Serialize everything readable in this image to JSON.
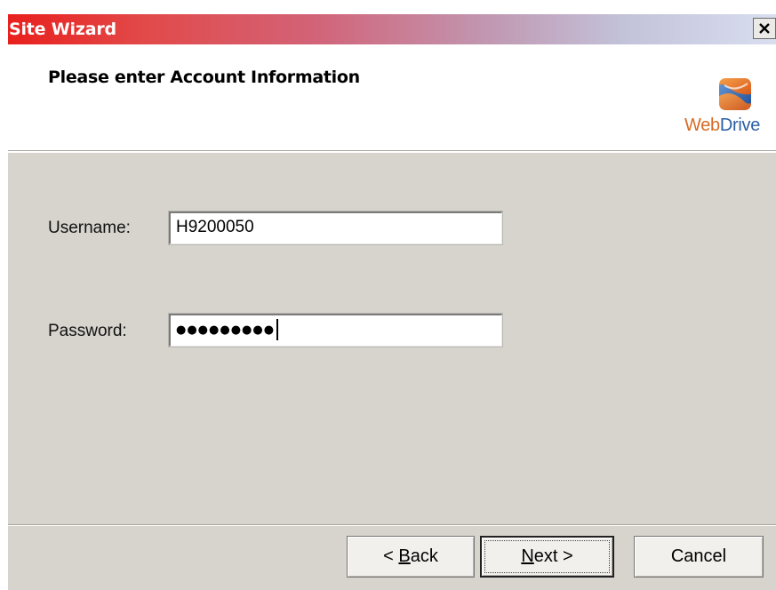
{
  "window": {
    "title": "Site Wizard"
  },
  "header": {
    "title": "Please enter Account Information",
    "logo_text_web": "Web",
    "logo_text_drive": "Drive"
  },
  "form": {
    "username_label": "Username:",
    "username_value": "H9200050",
    "password_label": "Password:",
    "password_mask": "●●●●●●●●●"
  },
  "buttons": {
    "back_prefix": "< ",
    "back_mnemonic": "B",
    "back_rest": "ack",
    "next_mnemonic": "N",
    "next_rest": "ext >",
    "cancel": "Cancel"
  },
  "colors": {
    "titlebar_start": "#e8201d",
    "titlebar_end": "#d9def0",
    "dialog_bg": "#d7d3cd",
    "logo_orange": "#d56a25",
    "logo_blue": "#2a5fa5"
  },
  "icons": {
    "close": "close-icon",
    "logo": "webdrive-logo-icon"
  }
}
